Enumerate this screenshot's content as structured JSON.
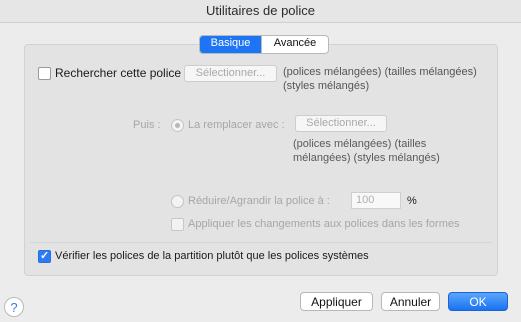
{
  "window": {
    "title": "Utilitaires de police"
  },
  "tabs": [
    {
      "label": "Basique",
      "selected": true
    },
    {
      "label": "Avancée",
      "selected": false
    }
  ],
  "search": {
    "checkbox_label": "Rechercher cette police :",
    "select_button": "Sélectionner...",
    "info_line1": "(polices mélangées) (tailles mélangées)",
    "info_line2": "(styles mélangés)"
  },
  "replace": {
    "puis_label": "Puis :",
    "radio_label": "La remplacer avec :",
    "select_button": "Sélectionner...",
    "info_line1": "(polices mélangées) (tailles",
    "info_line2": "mélangées) (styles mélangés)"
  },
  "scale": {
    "radio_label": "Réduire/Agrandir la police à :",
    "value": "100",
    "unit": "%"
  },
  "apply_forms": {
    "label": "Appliquer les changements aux polices dans les formes"
  },
  "verify": {
    "label": "Vérifier les polices de la partition plutôt que les polices systèmes",
    "checked": true
  },
  "footer": {
    "help": "?",
    "apply": "Appliquer",
    "cancel": "Annuler",
    "ok": "OK"
  },
  "colors": {
    "accent": "#1d74f5"
  }
}
